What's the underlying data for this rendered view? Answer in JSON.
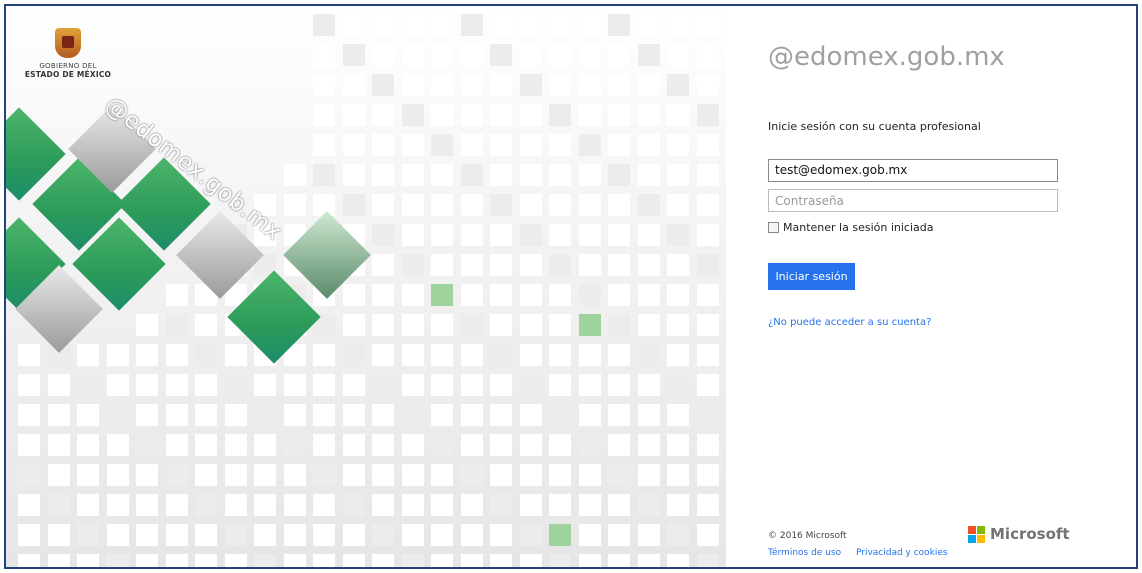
{
  "brand": {
    "logo_line1": "GOBIERNO DEL",
    "logo_line2": "ESTADO DE MÉXICO",
    "watermark": "@edomex.gob.mx"
  },
  "login": {
    "domain_title": "@edomex.gob.mx",
    "intro": "Inicie sesión con su cuenta profesional",
    "email_value": "test@edomex.gob.mx",
    "password_placeholder": "Contraseña",
    "keep_signed_in": "Mantener la sesión iniciada",
    "submit_label": "Iniciar sesión",
    "forgot_link": "¿No puede acceder a su cuenta?"
  },
  "footer": {
    "copyright": "© 2016 Microsoft",
    "terms": "Términos de uso",
    "privacy": "Privacidad y cookies",
    "ms_logo": "Microsoft"
  },
  "colors": {
    "accent": "#2672ec",
    "brand_green": "#2b9a5a",
    "frame": "#23437d"
  },
  "icons": {
    "logo": "estado-de-mexico-shield-icon",
    "microsoft": "microsoft-logo-icon"
  }
}
